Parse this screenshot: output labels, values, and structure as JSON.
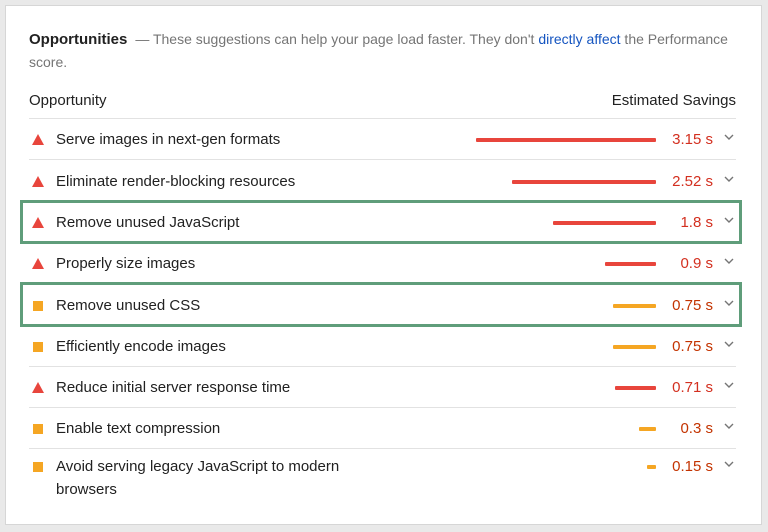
{
  "header": {
    "title": "Opportunities",
    "desc_before": "— These suggestions can help your page load faster. They don't ",
    "link": "directly affect",
    "desc_after": " the Performance score."
  },
  "columns": {
    "left": "Opportunity",
    "right": "Estimated Savings"
  },
  "colors": {
    "fail": "#e8453c",
    "average": "#f5a623",
    "fail_text": "#d32f1f",
    "average_text": "#c33300",
    "highlight": "#5f9d7a"
  },
  "max_savings": 3.15,
  "rows": [
    {
      "label": "Serve images in next-gen formats",
      "value": "3.15 s",
      "savings": 3.15,
      "severity": "fail",
      "icon": "warning-triangle-icon",
      "highlighted": false
    },
    {
      "label": "Eliminate render-blocking resources",
      "value": "2.52 s",
      "savings": 2.52,
      "severity": "fail",
      "icon": "warning-triangle-icon",
      "highlighted": false
    },
    {
      "label": "Remove unused JavaScript",
      "value": "1.8 s",
      "savings": 1.8,
      "severity": "fail",
      "icon": "warning-triangle-icon",
      "highlighted": true
    },
    {
      "label": "Properly size images",
      "value": "0.9 s",
      "savings": 0.9,
      "severity": "fail",
      "icon": "warning-triangle-icon",
      "highlighted": false
    },
    {
      "label": "Remove unused CSS",
      "value": "0.75 s",
      "savings": 0.75,
      "severity": "average",
      "icon": "orange-square-icon",
      "highlighted": true
    },
    {
      "label": "Efficiently encode images",
      "value": "0.75 s",
      "savings": 0.75,
      "severity": "average",
      "icon": "orange-square-icon",
      "highlighted": false
    },
    {
      "label": "Reduce initial server response time",
      "value": "0.71 s",
      "savings": 0.71,
      "severity": "fail",
      "icon": "warning-triangle-icon",
      "highlighted": false
    },
    {
      "label": "Enable text compression",
      "value": "0.3 s",
      "savings": 0.3,
      "severity": "average",
      "icon": "orange-square-icon",
      "highlighted": false
    },
    {
      "label": "Avoid serving legacy JavaScript to modern browsers",
      "value": "0.15 s",
      "savings": 0.15,
      "severity": "average",
      "icon": "orange-square-icon",
      "highlighted": false
    }
  ]
}
